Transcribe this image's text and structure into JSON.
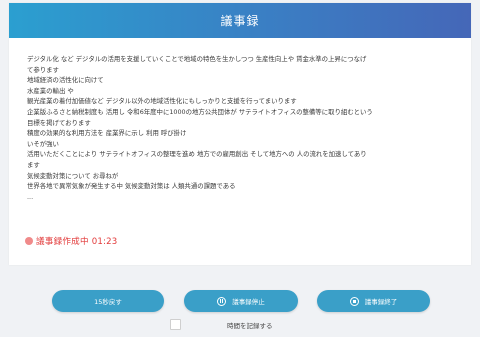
{
  "header": {
    "title": "議事録"
  },
  "transcript": {
    "lines": [
      "デジタル化 など デジタルの活用を支援していくことで地域の特色を生かしつつ 生産性向上や 賃金水準の上昇につなげ",
      "て参ります",
      "地域経済の活性化に向けて",
      "水産業の輸出 や",
      "観光産業の着付加価値など デジタル以外の地域活性化にもしっかりと支援を行ってまいります",
      "企業版ふるさと納税制度も 活用し 令和6年度中に1000の地方公共団体が サテライトオフィスの整備等に取り組むという",
      "目標を掲げております",
      "積度の効果的な利用方法を 産業界に示し 利用 呼び掛け",
      "いそが強い",
      "活用いただくことにより サテライトオフィスの整理を進め 地方での雇用創出 そして地方への 人の流れを加速してあり",
      "ます",
      "気候変動対策について お尋ねが",
      "世界各地で異常気象が発生する中 気候変動対策は 人類共通の課題である",
      "..."
    ]
  },
  "status": {
    "text": "議事録作成中 01:23",
    "color": "#e23a3a"
  },
  "controls": {
    "back_label": "15秒戻す",
    "pause_label": "議事録停止",
    "end_label": "議事録終了",
    "pause_icon": "pause-circle-icon",
    "end_icon": "stop-circle-icon"
  },
  "option": {
    "label": "時間を記録する",
    "checked": false
  },
  "colors": {
    "accent": "#3a9fc8",
    "header_start": "#2b9fd0",
    "header_end": "#4567b8",
    "recording": "#f08a8a"
  }
}
